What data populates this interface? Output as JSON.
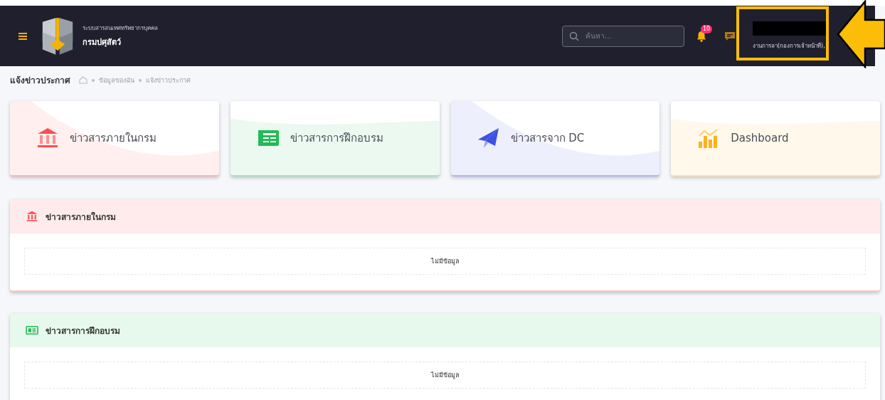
{
  "header": {
    "system_name": "ระบบสารสนเทศทรัพยากรบุคคล",
    "org_name": "กรมปศุสัตว์",
    "search": {
      "placeholder": "ค้นหา..."
    },
    "notifications": {
      "badge": "10"
    },
    "user": {
      "name_redacted": true,
      "role": "งานการลา(กองการเจ้าหน้าที่),"
    }
  },
  "annotation": {
    "highlight": true,
    "arrow": true
  },
  "breadcrumb": {
    "title": "แจ้งข่าวประกาศ",
    "items": [
      "ข้อมูลของฉัน",
      "แจ้งข่าวประกาศ"
    ]
  },
  "cards": [
    {
      "label": "ข่าวสารภายในกรม",
      "kind": "building",
      "color": "#ff4d4f"
    },
    {
      "label": "ข่าวสารการฝึกอบรม",
      "kind": "newspaper",
      "color": "#22bb55"
    },
    {
      "label": "ข่าวสารจาก DC",
      "kind": "plane",
      "color": "#3f51e0"
    },
    {
      "label": "Dashboard",
      "kind": "chart",
      "color": "#fbb320"
    }
  ],
  "sections": [
    {
      "title": "ข่าวสารภายในกรม",
      "kind": "building",
      "color": "#ff4d4f",
      "empty_text": "ไม่มีข้อมูล"
    },
    {
      "title": "ข่าวสารการฝึกอบรม",
      "kind": "newspaper",
      "color": "#22bb55",
      "empty_text": "ไม่มีข้อมูล"
    }
  ]
}
